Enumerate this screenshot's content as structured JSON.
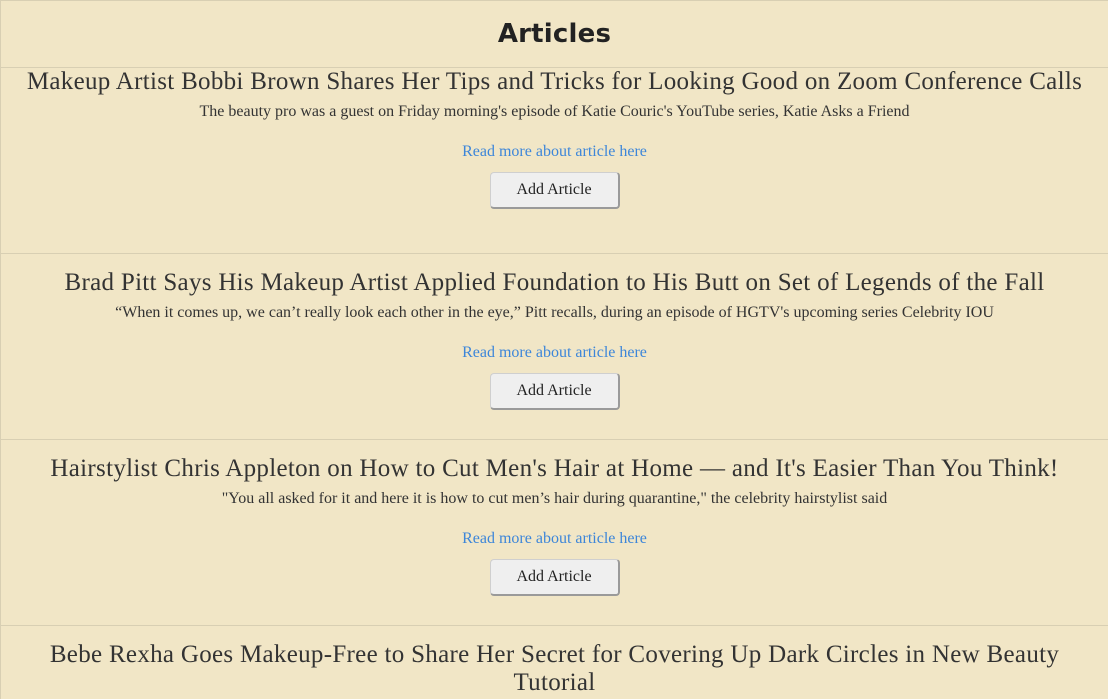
{
  "header": {
    "title": "Articles"
  },
  "articles": [
    {
      "title": "Makeup Artist Bobbi Brown Shares Her Tips and Tricks for Looking Good on Zoom Conference Calls",
      "description": "The beauty pro was a guest on Friday morning's episode of Katie Couric's YouTube series, Katie Asks a Friend",
      "link_text": "Read more about article here",
      "button_label": "Add Article"
    },
    {
      "title": "Brad Pitt Says His Makeup Artist Applied Foundation to His Butt on Set of Legends of the Fall",
      "description": "“When it comes up, we can’t really look each other in the eye,” Pitt recalls, during an episode of HGTV's upcoming series Celebrity IOU",
      "link_text": "Read more about article here",
      "button_label": "Add Article"
    },
    {
      "title": "Hairstylist Chris Appleton on How to Cut Men's Hair at Home — and It's Easier Than You Think!",
      "description": "\"You all asked for it and here it is how to cut men’s hair during quarantine,\" the celebrity hairstylist said",
      "link_text": "Read more about article here",
      "button_label": "Add Article"
    },
    {
      "title": "Bebe Rexha Goes Makeup-Free to Share Her Secret for Covering Up Dark Circles in New Beauty Tutorial"
    }
  ],
  "colors": {
    "background": "#f1e6c6",
    "link": "#3d86d9",
    "divider": "#d8cfb3"
  }
}
